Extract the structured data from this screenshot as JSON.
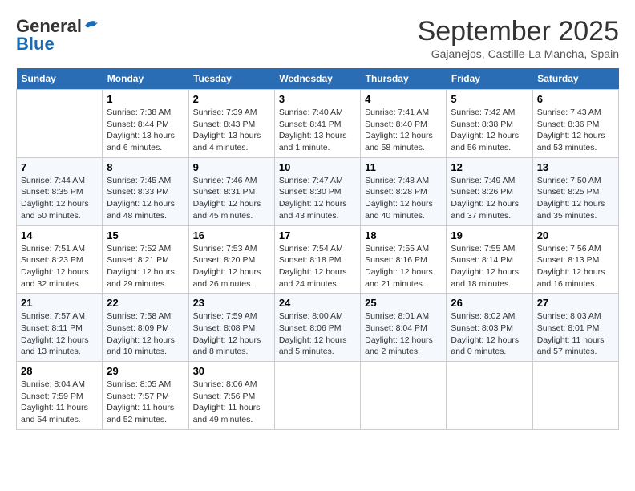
{
  "logo": {
    "general": "General",
    "blue": "Blue"
  },
  "header": {
    "month_title": "September 2025",
    "subtitle": "Gajanejos, Castille-La Mancha, Spain"
  },
  "weekdays": [
    "Sunday",
    "Monday",
    "Tuesday",
    "Wednesday",
    "Thursday",
    "Friday",
    "Saturday"
  ],
  "weeks": [
    [
      {
        "day": "",
        "sunrise": "",
        "sunset": "",
        "daylight": ""
      },
      {
        "day": "1",
        "sunrise": "Sunrise: 7:38 AM",
        "sunset": "Sunset: 8:44 PM",
        "daylight": "Daylight: 13 hours and 6 minutes."
      },
      {
        "day": "2",
        "sunrise": "Sunrise: 7:39 AM",
        "sunset": "Sunset: 8:43 PM",
        "daylight": "Daylight: 13 hours and 4 minutes."
      },
      {
        "day": "3",
        "sunrise": "Sunrise: 7:40 AM",
        "sunset": "Sunset: 8:41 PM",
        "daylight": "Daylight: 13 hours and 1 minute."
      },
      {
        "day": "4",
        "sunrise": "Sunrise: 7:41 AM",
        "sunset": "Sunset: 8:40 PM",
        "daylight": "Daylight: 12 hours and 58 minutes."
      },
      {
        "day": "5",
        "sunrise": "Sunrise: 7:42 AM",
        "sunset": "Sunset: 8:38 PM",
        "daylight": "Daylight: 12 hours and 56 minutes."
      },
      {
        "day": "6",
        "sunrise": "Sunrise: 7:43 AM",
        "sunset": "Sunset: 8:36 PM",
        "daylight": "Daylight: 12 hours and 53 minutes."
      }
    ],
    [
      {
        "day": "7",
        "sunrise": "Sunrise: 7:44 AM",
        "sunset": "Sunset: 8:35 PM",
        "daylight": "Daylight: 12 hours and 50 minutes."
      },
      {
        "day": "8",
        "sunrise": "Sunrise: 7:45 AM",
        "sunset": "Sunset: 8:33 PM",
        "daylight": "Daylight: 12 hours and 48 minutes."
      },
      {
        "day": "9",
        "sunrise": "Sunrise: 7:46 AM",
        "sunset": "Sunset: 8:31 PM",
        "daylight": "Daylight: 12 hours and 45 minutes."
      },
      {
        "day": "10",
        "sunrise": "Sunrise: 7:47 AM",
        "sunset": "Sunset: 8:30 PM",
        "daylight": "Daylight: 12 hours and 43 minutes."
      },
      {
        "day": "11",
        "sunrise": "Sunrise: 7:48 AM",
        "sunset": "Sunset: 8:28 PM",
        "daylight": "Daylight: 12 hours and 40 minutes."
      },
      {
        "day": "12",
        "sunrise": "Sunrise: 7:49 AM",
        "sunset": "Sunset: 8:26 PM",
        "daylight": "Daylight: 12 hours and 37 minutes."
      },
      {
        "day": "13",
        "sunrise": "Sunrise: 7:50 AM",
        "sunset": "Sunset: 8:25 PM",
        "daylight": "Daylight: 12 hours and 35 minutes."
      }
    ],
    [
      {
        "day": "14",
        "sunrise": "Sunrise: 7:51 AM",
        "sunset": "Sunset: 8:23 PM",
        "daylight": "Daylight: 12 hours and 32 minutes."
      },
      {
        "day": "15",
        "sunrise": "Sunrise: 7:52 AM",
        "sunset": "Sunset: 8:21 PM",
        "daylight": "Daylight: 12 hours and 29 minutes."
      },
      {
        "day": "16",
        "sunrise": "Sunrise: 7:53 AM",
        "sunset": "Sunset: 8:20 PM",
        "daylight": "Daylight: 12 hours and 26 minutes."
      },
      {
        "day": "17",
        "sunrise": "Sunrise: 7:54 AM",
        "sunset": "Sunset: 8:18 PM",
        "daylight": "Daylight: 12 hours and 24 minutes."
      },
      {
        "day": "18",
        "sunrise": "Sunrise: 7:55 AM",
        "sunset": "Sunset: 8:16 PM",
        "daylight": "Daylight: 12 hours and 21 minutes."
      },
      {
        "day": "19",
        "sunrise": "Sunrise: 7:55 AM",
        "sunset": "Sunset: 8:14 PM",
        "daylight": "Daylight: 12 hours and 18 minutes."
      },
      {
        "day": "20",
        "sunrise": "Sunrise: 7:56 AM",
        "sunset": "Sunset: 8:13 PM",
        "daylight": "Daylight: 12 hours and 16 minutes."
      }
    ],
    [
      {
        "day": "21",
        "sunrise": "Sunrise: 7:57 AM",
        "sunset": "Sunset: 8:11 PM",
        "daylight": "Daylight: 12 hours and 13 minutes."
      },
      {
        "day": "22",
        "sunrise": "Sunrise: 7:58 AM",
        "sunset": "Sunset: 8:09 PM",
        "daylight": "Daylight: 12 hours and 10 minutes."
      },
      {
        "day": "23",
        "sunrise": "Sunrise: 7:59 AM",
        "sunset": "Sunset: 8:08 PM",
        "daylight": "Daylight: 12 hours and 8 minutes."
      },
      {
        "day": "24",
        "sunrise": "Sunrise: 8:00 AM",
        "sunset": "Sunset: 8:06 PM",
        "daylight": "Daylight: 12 hours and 5 minutes."
      },
      {
        "day": "25",
        "sunrise": "Sunrise: 8:01 AM",
        "sunset": "Sunset: 8:04 PM",
        "daylight": "Daylight: 12 hours and 2 minutes."
      },
      {
        "day": "26",
        "sunrise": "Sunrise: 8:02 AM",
        "sunset": "Sunset: 8:03 PM",
        "daylight": "Daylight: 12 hours and 0 minutes."
      },
      {
        "day": "27",
        "sunrise": "Sunrise: 8:03 AM",
        "sunset": "Sunset: 8:01 PM",
        "daylight": "Daylight: 11 hours and 57 minutes."
      }
    ],
    [
      {
        "day": "28",
        "sunrise": "Sunrise: 8:04 AM",
        "sunset": "Sunset: 7:59 PM",
        "daylight": "Daylight: 11 hours and 54 minutes."
      },
      {
        "day": "29",
        "sunrise": "Sunrise: 8:05 AM",
        "sunset": "Sunset: 7:57 PM",
        "daylight": "Daylight: 11 hours and 52 minutes."
      },
      {
        "day": "30",
        "sunrise": "Sunrise: 8:06 AM",
        "sunset": "Sunset: 7:56 PM",
        "daylight": "Daylight: 11 hours and 49 minutes."
      },
      {
        "day": "",
        "sunrise": "",
        "sunset": "",
        "daylight": ""
      },
      {
        "day": "",
        "sunrise": "",
        "sunset": "",
        "daylight": ""
      },
      {
        "day": "",
        "sunrise": "",
        "sunset": "",
        "daylight": ""
      },
      {
        "day": "",
        "sunrise": "",
        "sunset": "",
        "daylight": ""
      }
    ]
  ]
}
